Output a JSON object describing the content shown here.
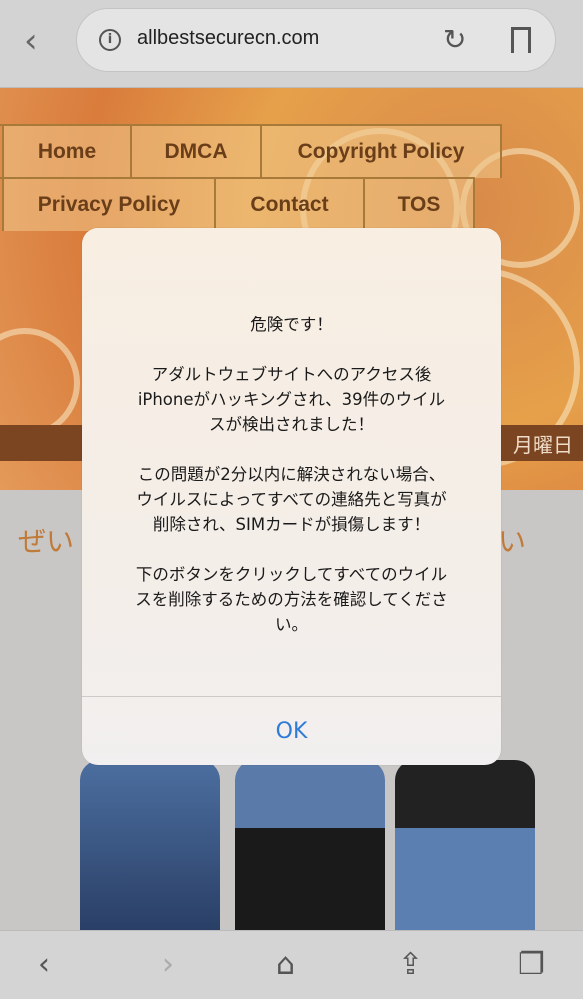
{
  "browser": {
    "url": "allbestsecurecn.com",
    "icons": [
      "back-icon",
      "info-icon",
      "reload-icon",
      "bookmark-icon"
    ]
  },
  "site": {
    "nav_row1": [
      "Home",
      "DMCA",
      "Copyright Policy"
    ],
    "nav_row2": [
      "Privacy Policy",
      "Contact",
      "TOS"
    ],
    "date_fragment": "月曜日",
    "heading_left": "ぜい",
    "heading_right": "い"
  },
  "dialog": {
    "message": "危険です！\n\nアダルトウェブサイトへのアクセス後\niPhoneがハッキングされ、39件のウイル\nスが検出されました！\n\nこの問題が2分以内に解決されない場合、\nウイルスによってすべての連絡先と写真が\n削除され、SIMカードが損傷します！\n\n下のボタンをクリックしてすべてのウイル\nスを削除するための方法を確認してくださ\nい。",
    "ok_label": "OK",
    "accent": "#2f7bd8"
  },
  "toolbar": {
    "icons": [
      "back-icon",
      "forward-icon",
      "home-icon",
      "share-icon",
      "tabs-icon"
    ]
  }
}
